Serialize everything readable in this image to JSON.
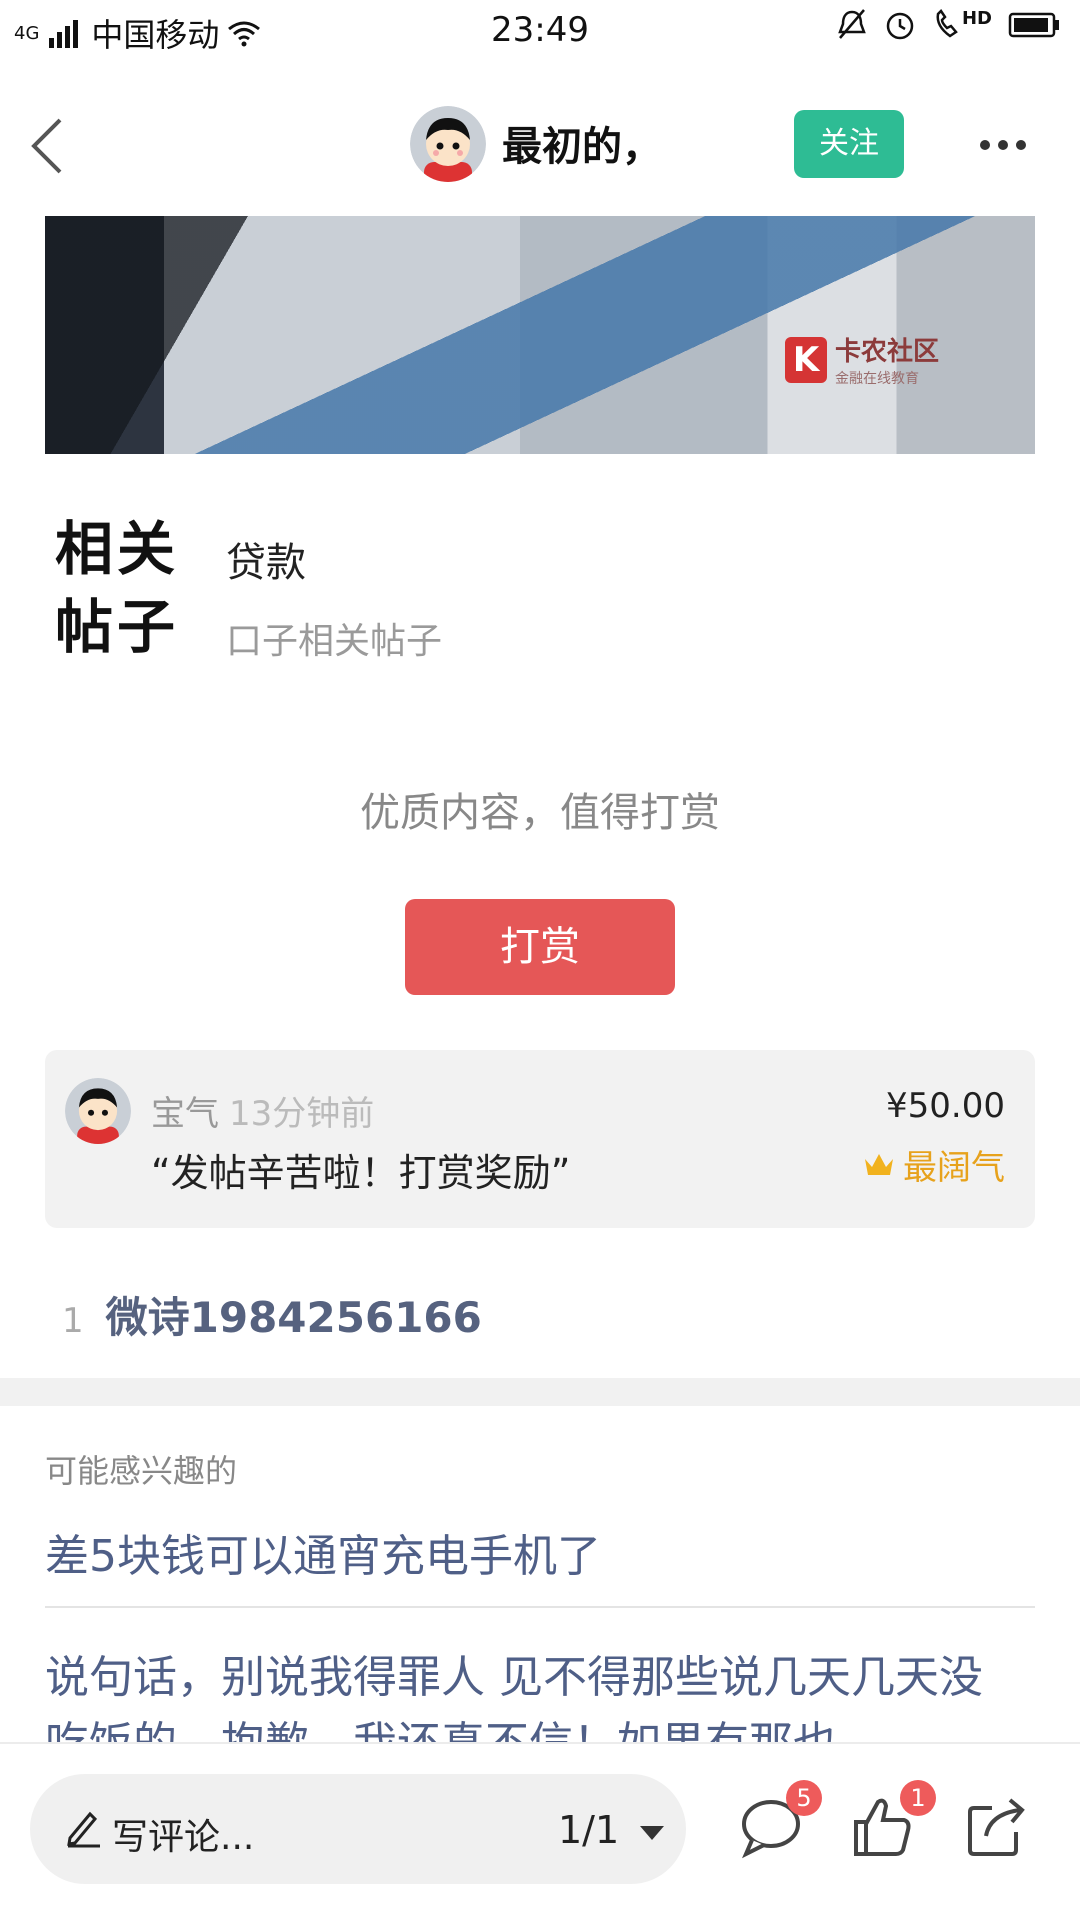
{
  "status_bar": {
    "network": "4G",
    "carrier": "中国移动",
    "time": "23:49",
    "hd_label": "HD"
  },
  "nav": {
    "author_name": "最初的，",
    "follow_label": "关注"
  },
  "hero": {
    "watermark_title": "卡农社区",
    "watermark_sub": "金融在线教育"
  },
  "related": {
    "badge_line1": "相关",
    "badge_line2": "帖子",
    "title": "贷款",
    "subtitle": "口子相关帖子"
  },
  "tip": {
    "prompt": "优质内容，值得打赏",
    "button_label": "打赏"
  },
  "tip_card": {
    "name": "宝气",
    "time": "13分钟前",
    "message": "“发帖辛苦啦！打赏奖励”",
    "amount": "¥50.00",
    "badge": "最阔气"
  },
  "rank": {
    "number": "1",
    "name": "微诗1984256166"
  },
  "interest": {
    "heading": "可能感兴趣的",
    "items": [
      "差5块钱可以通宵充电手机了",
      "说句话，别说我得罪人 见不得那些说几天几天没吃饭的，抱歉，我还真不信！如果有那也"
    ]
  },
  "bottom_bar": {
    "comment_placeholder": "写评论...",
    "page_indicator": "1/1",
    "comment_count": "5",
    "like_count": "1"
  },
  "colors": {
    "follow": "#2ebc94",
    "tip_button": "#e55757",
    "link": "#4f5f87",
    "badge_gold": "#e7a21c",
    "count_badge": "#ee5b5b"
  }
}
